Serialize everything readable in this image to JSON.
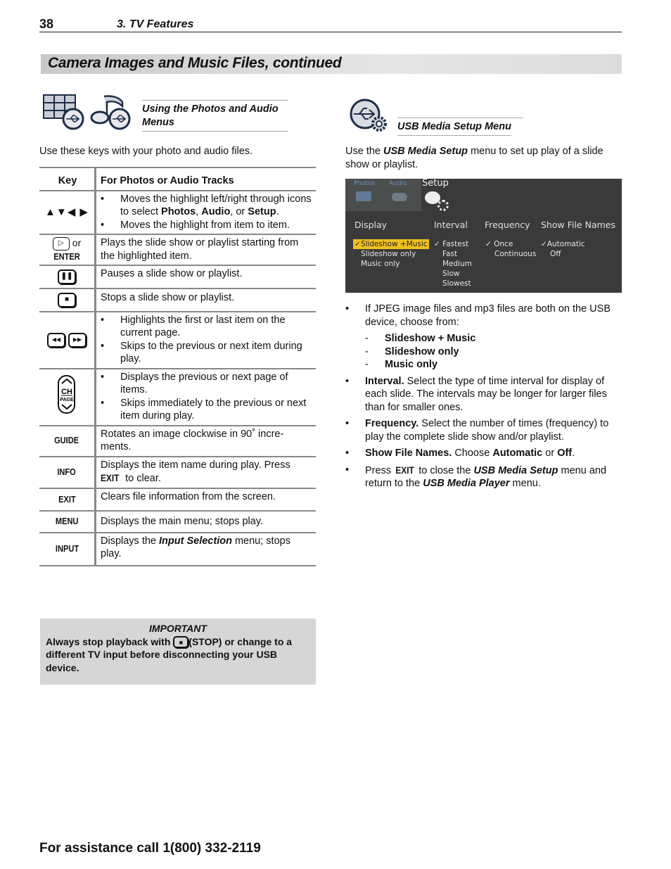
{
  "header": {
    "page_number": "38",
    "chapter": "3.  TV Features"
  },
  "section_title": "Camera Images and Music Files, continued",
  "left": {
    "icons": [
      "photos-usb-icon",
      "audio-usb-icon"
    ],
    "subhead": "Using the Photos and Audio Menus",
    "intro": "Use these keys with your photo and audio files.",
    "table": {
      "headers": [
        "Key",
        "For Photos or Audio Tracks"
      ],
      "rows": [
        {
          "key": "▲▼◀ ▶",
          "key_icon": "arrow-keys-icon",
          "bullets": [
            "Moves the highlight left/right through icons to select |Photos|, |Audio|, or |Setup|.",
            "Moves the highlight from item to item."
          ]
        },
        {
          "key": "or ENTER",
          "key_icon": "play-button-icon",
          "text": "Plays the slide show or playlist starting from the highlighted item."
        },
        {
          "key": "",
          "key_icon": "pause-button-icon",
          "text": "Pauses a slide show or playlist."
        },
        {
          "key": "",
          "key_icon": "stop-button-icon",
          "text": "Stops a slide show or playlist."
        },
        {
          "key": "",
          "key_icon": "skip-buttons-icon",
          "bullets": [
            "Highlights the first or last item on the current page.",
            "Skips to the previous or next item during play."
          ]
        },
        {
          "key": "CH PAGE",
          "key_icon": "ch-page-rocker-icon",
          "bullets": [
            "Displays the previous or next page of items.",
            "Skips immediately to the previous or next item during play."
          ]
        },
        {
          "key": "GUIDE",
          "text": "Rotates an image clockwise in 90˚ incre-ments."
        },
        {
          "key": "INFO",
          "text_pre": "Displays the item name during play.  Press ",
          "text_key": "EXIT",
          "text_post": " to clear."
        },
        {
          "key": "EXIT",
          "text": "Clears file information from the screen."
        },
        {
          "key": "MENU",
          "text": "Displays the main menu; stops play."
        },
        {
          "key": "INPUT",
          "text_pre": "Displays the ",
          "text_em": "Input Selection",
          "text_post": " menu; stops play."
        }
      ]
    },
    "important": {
      "title": "IMPORTANT",
      "pre": "Always stop playback with ",
      "post": "(STOP) or change to a different TV input before disconnecting your USB device."
    }
  },
  "right": {
    "subhead": "USB Media Setup Menu",
    "intro_pre": "Use the ",
    "intro_em": "USB Media Setup",
    "intro_post": " menu to set up play of a slide show or playlist.",
    "screen": {
      "tabs": [
        "Photos",
        "Audio",
        "Setup"
      ],
      "columns": [
        {
          "label": "Display",
          "options": [
            "Slideshow +Music",
            "Slideshow only",
            "Music only"
          ],
          "selected": 0
        },
        {
          "label": "Interval",
          "options": [
            "Fastest",
            "Fast",
            "Medium",
            "Slow",
            "Slowest"
          ],
          "selected": 0
        },
        {
          "label": "Frequency",
          "options": [
            "Once",
            "Continuous"
          ],
          "selected": 0
        },
        {
          "label": "Show File Names",
          "options": [
            "Automatic",
            "Off"
          ],
          "selected": 0
        }
      ],
      "highlight_color": "#f0c020"
    },
    "bullets": {
      "jpeg": "If JPEG image files and mp3 files are both on the USB device, choose from:",
      "choices": [
        "Slideshow + Music",
        "Slideshow only",
        "Music only"
      ],
      "interval_term": "Interval.",
      "interval_text": "  Select the type of time interval for display of each slide.  The intervals may be longer for larger files than for smaller ones.",
      "frequency_term": "Frequency.",
      "frequency_text": "  Select the number of times (frequency) to play the complete slide show and/or playlist.",
      "sfn_term": "Show File Names.",
      "sfn_text1": "  Choose ",
      "sfn_auto": "Automatic",
      "sfn_or": " or ",
      "sfn_off": "Off",
      "exit_pre": "Press ",
      "exit_key": "EXIT",
      "exit_mid": " to close the ",
      "exit_em1": "USB Media Setup",
      "exit_mid2": " menu and return to the ",
      "exit_em2": "USB Media Player",
      "exit_post": " menu."
    }
  },
  "footer": "For assistance call 1(800) 332-2119"
}
